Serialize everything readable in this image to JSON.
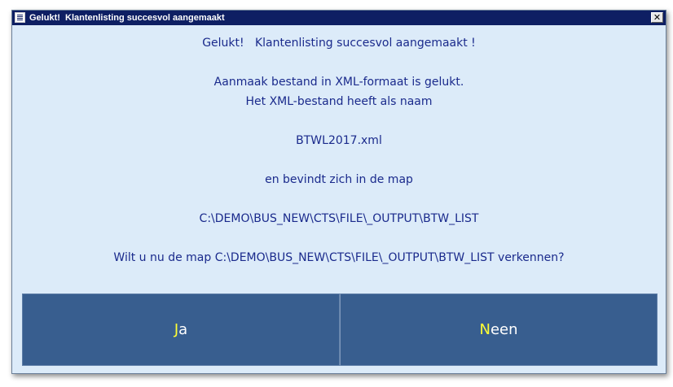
{
  "window": {
    "title": "Gelukt!  Klantenlisting succesvol aangemaakt",
    "close_label": "✕"
  },
  "message": {
    "line1": "Gelukt!   Klantenlisting succesvol aangemaakt !",
    "line2": "Aanmaak bestand in XML-formaat is gelukt.",
    "line3": "Het XML-bestand heeft als naam",
    "filename": "BTWL2017.xml",
    "line4": "en bevindt zich in de map",
    "folder": "C:\\DEMO\\BUS_NEW\\CTS\\FILE\\_OUTPUT\\BTW_LIST",
    "question": "Wilt u nu de map C:\\DEMO\\BUS_NEW\\CTS\\FILE\\_OUTPUT\\BTW_LIST verkennen?"
  },
  "buttons": {
    "yes_hotkey": "J",
    "yes_rest": "a",
    "no_hotkey": "N",
    "no_rest": "een"
  },
  "colors": {
    "titlebar": "#0e1f63",
    "dialog_bg": "#dcebf9",
    "text": "#1a2a8c",
    "button_bg": "#385e8f",
    "hotkey": "#ffff33"
  },
  "icons": {
    "system_menu": "window-menu-icon",
    "close": "close-icon"
  }
}
